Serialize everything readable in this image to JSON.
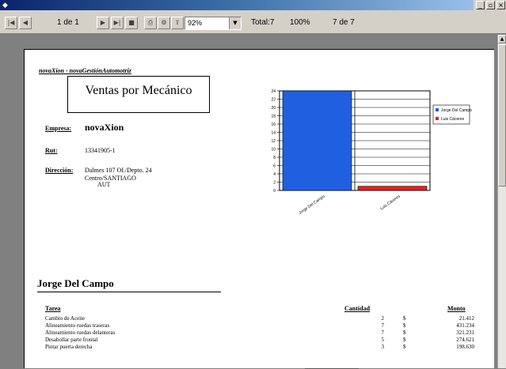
{
  "titlebar": {
    "buttons": [
      "_",
      "▫",
      "×"
    ]
  },
  "toolbar": {
    "page_indicator": "1 de 1",
    "zoom_value": "92%",
    "total": "Total:7",
    "percent": "100%",
    "record": "7 de 7"
  },
  "report": {
    "app_header": "novaXion - novaGestiónAutomotriz",
    "title": "Ventas por Mecánico",
    "company_label": "Empresa:",
    "company": "novaXion",
    "rut_label": "Rut:",
    "rut": "13341905-1",
    "address_label": "Dirección:",
    "address_line1": "Dalmes 107 Of./Depto. 24",
    "address_line2": "Centro/SANTIAGO",
    "address_line3": "AUT"
  },
  "chart_data": {
    "type": "bar",
    "categories": [
      "Jorge Del Campo",
      "Luis Cáceres"
    ],
    "series": [
      {
        "name": "Jorge Del Campo",
        "values": [
          24
        ],
        "color": "#1f5fe0"
      },
      {
        "name": "Luis Cáceres",
        "values": [
          1
        ],
        "color": "#e02020"
      }
    ],
    "values": [
      24,
      1
    ],
    "ylim": [
      0,
      24
    ],
    "yticks": [
      "0",
      "2",
      "4",
      "6",
      "8",
      "10",
      "12",
      "14",
      "16",
      "18",
      "20",
      "22",
      "24"
    ],
    "legend": [
      "Jorge Del Campo",
      "Luis Cáceres"
    ],
    "legend_placement": "right",
    "grid": true
  },
  "mechanic": {
    "name": "Jorge Del Campo",
    "headers": {
      "task": "Tarea",
      "qty": "Cantidad",
      "amount": "Monto"
    },
    "currency": "$",
    "rows": [
      {
        "task": "Cambio de Aceite",
        "qty": "2",
        "amount": "21.412"
      },
      {
        "task": "Alineamiento ruedas traseras",
        "qty": "7",
        "amount": "431.234"
      },
      {
        "task": "Alineamiento ruedas delanteras",
        "qty": "7",
        "amount": "321.231"
      },
      {
        "task": "Desabollar parte frontal",
        "qty": "5",
        "amount": "274.621"
      },
      {
        "task": "Pintar puerta derecha",
        "qty": "3",
        "amount": "198.630"
      }
    ]
  }
}
